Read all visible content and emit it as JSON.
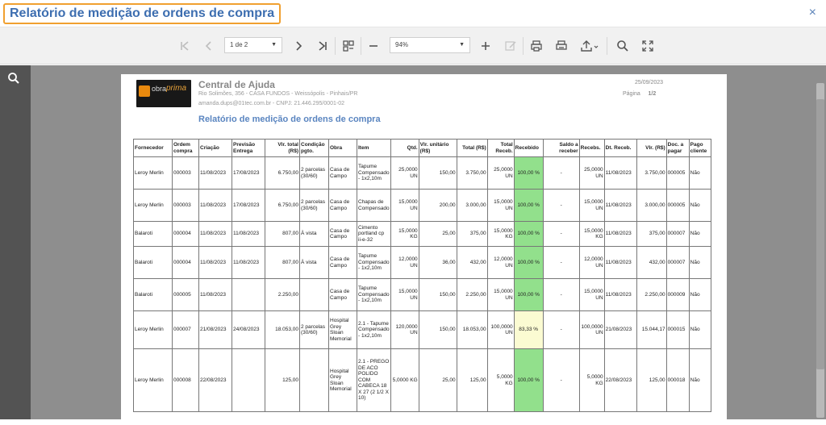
{
  "window": {
    "title": "Relatório de medição de ordens de compra",
    "close_label": "×"
  },
  "toolbar": {
    "page_select": "1 de 2",
    "zoom_select": "94%",
    "icons": [
      "first-page-icon",
      "prev-page-icon",
      "next-page-icon",
      "last-page-icon",
      "multipage-icon",
      "zoom-out-icon",
      "zoom-in-icon",
      "edit-icon",
      "print-icon",
      "print-page-icon",
      "export-icon",
      "search-icon",
      "fullscreen-icon"
    ]
  },
  "report": {
    "logo_text_1": "obra",
    "logo_text_2": "prima",
    "company": "Central de Ajuda",
    "address": "Rio Solimões, 356 - CASA FUNDOS - Weissópolis - Pinhais/PR",
    "contact": "amanda.dups@01tec.com.br - CNPJ: 21.446.295/0001-02",
    "date": "25/09/2023",
    "page_label": "Página",
    "page_value": "1/2",
    "title": "Relatório de medição de ordens de compra",
    "columns": [
      "Fornecedor",
      "Ordem compra",
      "Criação",
      "Previsão Entrega",
      "Vlr. total (R$)",
      "Condição pgto.",
      "Obra",
      "Item",
      "Qtd.",
      "Vlr. unitário (R$)",
      "Total (R$)",
      "Total Receb.",
      "Recebido",
      "Saldo a receber",
      "Recebs.",
      "Dt. Receb.",
      "Vlr. (R$)",
      "Doc. a pagar",
      "Pago cliente"
    ],
    "rows": [
      [
        "Leroy Merlin",
        "000003",
        "11/08/2023",
        "17/08/2023",
        "6.750,00",
        "2 parcelas (30/60)",
        "Casa de Campo",
        "Tapume Compensado - 1x2,10m",
        "25,0000 UN",
        "150,00",
        "3.750,00",
        "25,0000 UN",
        "100,00 %",
        "-",
        "25,0000 UN",
        "11/08/2023",
        "3.750,00",
        "000005",
        "Não"
      ],
      [
        "Leroy Merlin",
        "000003",
        "11/08/2023",
        "17/08/2023",
        "6.750,00",
        "2 parcelas (30/60)",
        "Casa de Campo",
        "Chapas de Compensado",
        "15,0000 UN",
        "200,00",
        "3.000,00",
        "15,0000 UN",
        "100,00 %",
        "-",
        "15,0000 UN",
        "11/08/2023",
        "3.000,00",
        "000005",
        "Não"
      ],
      [
        "Balaroti",
        "000004",
        "11/08/2023",
        "11/08/2023",
        "807,00",
        "À vista",
        "Casa de Campo",
        "Cimento portland cp ii-e-32",
        "15,0000 KG",
        "25,00",
        "375,00",
        "15,0000 KG",
        "100,00 %",
        "-",
        "15,0000 KG",
        "11/08/2023",
        "375,00",
        "000007",
        "Não"
      ],
      [
        "Balaroti",
        "000004",
        "11/08/2023",
        "11/08/2023",
        "807,00",
        "À vista",
        "Casa de Campo",
        "Tapume Compensado - 1x2,10m",
        "12,0000 UN",
        "36,00",
        "432,00",
        "12,0000 UN",
        "100,00 %",
        "-",
        "12,0000 UN",
        "11/08/2023",
        "432,00",
        "000007",
        "Não"
      ],
      [
        "Balaroti",
        "000005",
        "11/08/2023",
        "",
        "2.250,00",
        "",
        "Casa de Campo",
        "Tapume Compensado - 1x2,10m",
        "15,0000 UN",
        "150,00",
        "2.250,00",
        "15,0000 UN",
        "100,00 %",
        "-",
        "15,0000 UN",
        "11/08/2023",
        "2.250,00",
        "000009",
        "Não"
      ],
      [
        "Leroy Merlin",
        "000007",
        "21/08/2023",
        "24/08/2023",
        "18.053,00",
        "2 parcelas (30/60)",
        "Hospital Grey Sloan Memorial",
        "2.1 - Tapume Compensado - 1x2,10m",
        "120,0000 UN",
        "150,00",
        "18.053,00",
        "100,0000 UN",
        "83,33 %",
        "-",
        "100,0000 UN",
        "21/08/2023",
        "15.044,17",
        "000015",
        "Não"
      ],
      [
        "Leroy Merlin",
        "000008",
        "22/08/2023",
        "",
        "125,00",
        "",
        "Hospital Grey Sloan Memorial",
        "2.1 - PREGO DE ACO POLIDO COM CABECA 18 X 27 (2 1/2 X 10)",
        "5,0000 KG",
        "25,00",
        "125,00",
        "5,0000 KG",
        "100,00 %",
        "-",
        "5,0000 KG",
        "22/08/2023",
        "125,00",
        "000018",
        "Não"
      ]
    ],
    "received_levels": [
      1.0,
      1.0,
      1.0,
      1.0,
      1.0,
      0.8333,
      1.0
    ]
  },
  "colors": {
    "accent": "#3d6eb0",
    "highlight_border": "#f0a030",
    "received_full": "#92e08c",
    "received_partial": "#fbfbd2",
    "viewer_bg": "#8e8e8e"
  }
}
